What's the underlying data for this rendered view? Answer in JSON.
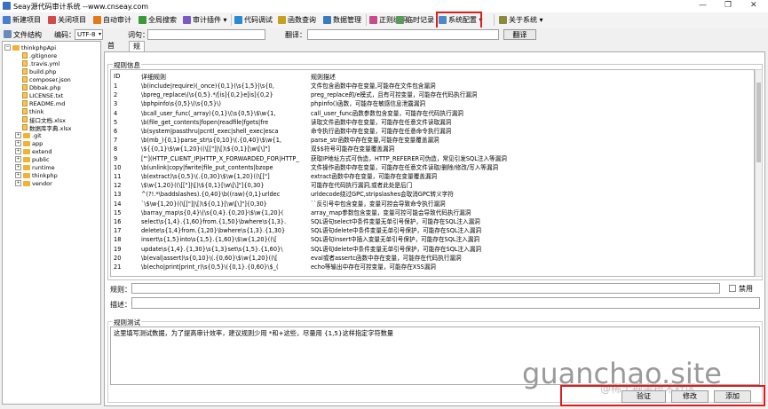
{
  "window": {
    "title": "Seay源代码审计系统   --www.cnseay.com",
    "controls": [
      "—",
      "❐",
      "✕"
    ]
  },
  "toolbar": {
    "items": [
      {
        "label": "新建项目",
        "icon": "new-project-icon",
        "color": "#4a7fd0"
      },
      {
        "label": "关闭项目",
        "icon": "close-project-icon",
        "color": "#d04a4a"
      },
      {
        "label": "自动审计",
        "icon": "auto-audit-icon",
        "color": "#e07a1a"
      },
      {
        "label": "全局搜索",
        "icon": "global-search-icon",
        "color": "#3a9a3a"
      },
      {
        "label": "审计插件 ▾",
        "icon": "plugin-icon",
        "color": "#7a5ac8"
      },
      {
        "label": "代码调试",
        "icon": "debug-icon",
        "color": "#2a8ad0"
      },
      {
        "label": "函数查询",
        "icon": "function-query-icon",
        "color": "#c8a020"
      },
      {
        "label": "数据管理",
        "icon": "data-manage-icon",
        "color": "#3a7ac0"
      },
      {
        "label": "正则编码",
        "icon": "regex-icon",
        "color": "#c84a8a"
      },
      {
        "label": "临时记录",
        "icon": "note-icon",
        "color": "#5a9a5a"
      },
      {
        "label": "系统配置 ▾",
        "icon": "system-config-icon",
        "color": "#4a8ac8"
      },
      {
        "label": "关于系统 ▾",
        "icon": "about-icon",
        "color": "#8a8a3a"
      }
    ]
  },
  "searchbar": {
    "file_structure": "文件结构",
    "encoding_label": "编码：",
    "encoding_value": "UTF-8",
    "word_label": "词句：",
    "translate_label": "翻译：",
    "translate_button": "翻译"
  },
  "tree": {
    "root": "thinkphpApi",
    "items": [
      {
        "label": ".gitignore",
        "type": "file"
      },
      {
        "label": ".travis.yml",
        "type": "file"
      },
      {
        "label": "build.php",
        "type": "file"
      },
      {
        "label": "composer.json",
        "type": "file"
      },
      {
        "label": "Dbbak.php",
        "type": "file"
      },
      {
        "label": "LICENSE.txt",
        "type": "file"
      },
      {
        "label": "README.md",
        "type": "file"
      },
      {
        "label": "think",
        "type": "file"
      },
      {
        "label": "接口文档.xlsx",
        "type": "file"
      },
      {
        "label": "数据库字典.xlsx",
        "type": "file"
      },
      {
        "label": ".git",
        "type": "folder"
      },
      {
        "label": "app",
        "type": "folder"
      },
      {
        "label": "extend",
        "type": "folder"
      },
      {
        "label": "public",
        "type": "folder"
      },
      {
        "label": "runtime",
        "type": "folder"
      },
      {
        "label": "thinkphp",
        "type": "folder"
      },
      {
        "label": "vendor",
        "type": "folder"
      }
    ]
  },
  "tabs": [
    {
      "label": "首页"
    },
    {
      "label": "规则管理"
    }
  ],
  "rules": {
    "group_title": "规则信息",
    "headers": {
      "id": "ID",
      "regex": "详细规则",
      "desc": "规则描述"
    },
    "rows": [
      {
        "id": "1",
        "regex": "\\b(include|require)(_once){0,1}(\\s{1,5}|\\s{0,",
        "desc": "文件包含函数中存在变量,可能存在文件包含漏洞"
      },
      {
        "id": "2",
        "regex": "\\bpreg_replace\\(\\s{0,5}.*/[is]{0,2}e[is]{0,2}",
        "desc": "preg_replace的/e模式，且有可控变量，可能存在代码执行漏洞"
      },
      {
        "id": "3",
        "regex": "\\bphpinfo\\s{0,5}\\(\\s{0,5}\\)",
        "desc": "phpinfo()函数，可能存在敏感信息泄露漏洞"
      },
      {
        "id": "4",
        "regex": "\\bcall_user_func(_array){0,1}\\(\\s{0,5}\\$\\w{1,",
        "desc": "call_user_func函数参数包含变量，可能存在代码执行漏洞"
      },
      {
        "id": "5",
        "regex": "\\b(file_get_contents|fopen|readfile|fgets|fre",
        "desc": "读取文件函数中存在变量，可能存在任意文件读取漏洞"
      },
      {
        "id": "6",
        "regex": "\\b(system|passthru|pcntl_exec|shell_exec|esca",
        "desc": "命令执行函数中存在变量，可能存在任意命令执行漏洞"
      },
      {
        "id": "7",
        "regex": "\\b(mb_){0,1}parse_str\\s{0,10}\\(.{0,40}\\$\\w{1,",
        "desc": "parse_str函数中存在变量,可能存在变量覆盖漏洞"
      },
      {
        "id": "8",
        "regex": "\\${{0,1}\\$\\w{1,20}((\\[[\"]|\\[)\\${0,1}[\\w\\[\\]\"]",
        "desc": "双$$符号可能存在变量覆盖漏洞"
      },
      {
        "id": "9",
        "regex": "[\"'](HTTP_CLIENT_IP|HTTP_X_FORWARDED_FOR|HTTP_",
        "desc": "获取IP地址方式可伪造，HTTP_REFERER可伪造，常见引发SQL注入等漏洞"
      },
      {
        "id": "10",
        "regex": "\\b(unlink|copy|fwrite|file_put_contents|bzope",
        "desc": "文件操作函数中存在变量，可能存在任意文件读取/删除/修改/写入等漏洞"
      },
      {
        "id": "11",
        "regex": "\\b(extract)\\s{0,5}\\(.{0,30}\\$\\w{1,20}((\\[[\"]",
        "desc": "extract函数中存在变量，可能存在变量覆盖漏洞"
      },
      {
        "id": "12",
        "regex": "\\$\\w{1,20}((\\[[\"]|\\[)\\${0,1}[\\w\\[\\]\"]{0,30}",
        "desc": "可能存在代码执行漏洞,或者此处是后门"
      },
      {
        "id": "13",
        "regex": "^(?!.*\\baddslashes).{0,40}\\b((raw){0,1}urldec",
        "desc": "urldecode绕过GPC,stripslashes会取消GPC转义字符"
      },
      {
        "id": "14",
        "regex": "`\\$\\w{1,20}((\\[[\"]|\\[)\\${0,1}[\\w\\[\\]\"]{0,30}",
        "desc": "``反引号中包含变量，变量可控会导致命令执行漏洞"
      },
      {
        "id": "15",
        "regex": "\\barray_map\\s{0,4}\\(\\s{0,4}.{0,20}\\$\\w{1,20}(",
        "desc": "array_map参数包含变量，变量可控可能会导致代码执行漏洞"
      },
      {
        "id": "16",
        "regex": "select\\s{1,4}.{1,60}from.{1,50}\\bwhere\\s{1,3}.",
        "desc": "SQL语句select中条件变量无单引号保护，可能存在SQL注入漏洞"
      },
      {
        "id": "17",
        "regex": "delete\\s{1,4}from.{1,20}\\bwhere\\s{1,3}.{1,30}",
        "desc": "SQL语句delete中条件变量无单引号保护，可能存在SQL注入漏洞"
      },
      {
        "id": "18",
        "regex": "insert\\s{1,5}into\\s{1,5}.{1,60}\\$\\w{1,20}((\\[",
        "desc": "SQL语句insert中插入变量无单引号保护，可能存在SQL注入漏洞"
      },
      {
        "id": "19",
        "regex": "update\\s{1,4}.{1,30}\\s{1,3}set\\s{1,5}.{1,60}\\",
        "desc": "SQL语句delete中条件变量无单引号保护，可能存在SQL注入漏洞"
      },
      {
        "id": "20",
        "regex": "\\b(eval|assert)\\s{0,10}\\(.{0,60}\\$\\w{1,20}((\\[",
        "desc": "eval或者assertc函数中存在变量，可能存在代码执行漏洞"
      },
      {
        "id": "21",
        "regex": "\\b(echo|print|print_r)\\s{0,5}\\({0,1}.{0,60}\\$_(",
        "desc": "echo等输出中存在可控变量，可能存在XSS漏洞"
      }
    ]
  },
  "form": {
    "rule_label": "规则：",
    "disable_label": "禁用",
    "desc_label": "描述："
  },
  "test": {
    "group_title": "规则测试",
    "placeholder_text": "这里填写测试数据，为了提高审计效率，建议规则少用 *和+这些，尽量用 {1,5}这样指定字符数量"
  },
  "actions": {
    "verify": "验证",
    "modify": "修改",
    "add": "添加"
  },
  "watermarks": {
    "big": "guanchao.site",
    "small": "@稀土掘金技术社区"
  },
  "colors": {
    "highlight": "#e21b1b",
    "folder": "#f2b233"
  }
}
